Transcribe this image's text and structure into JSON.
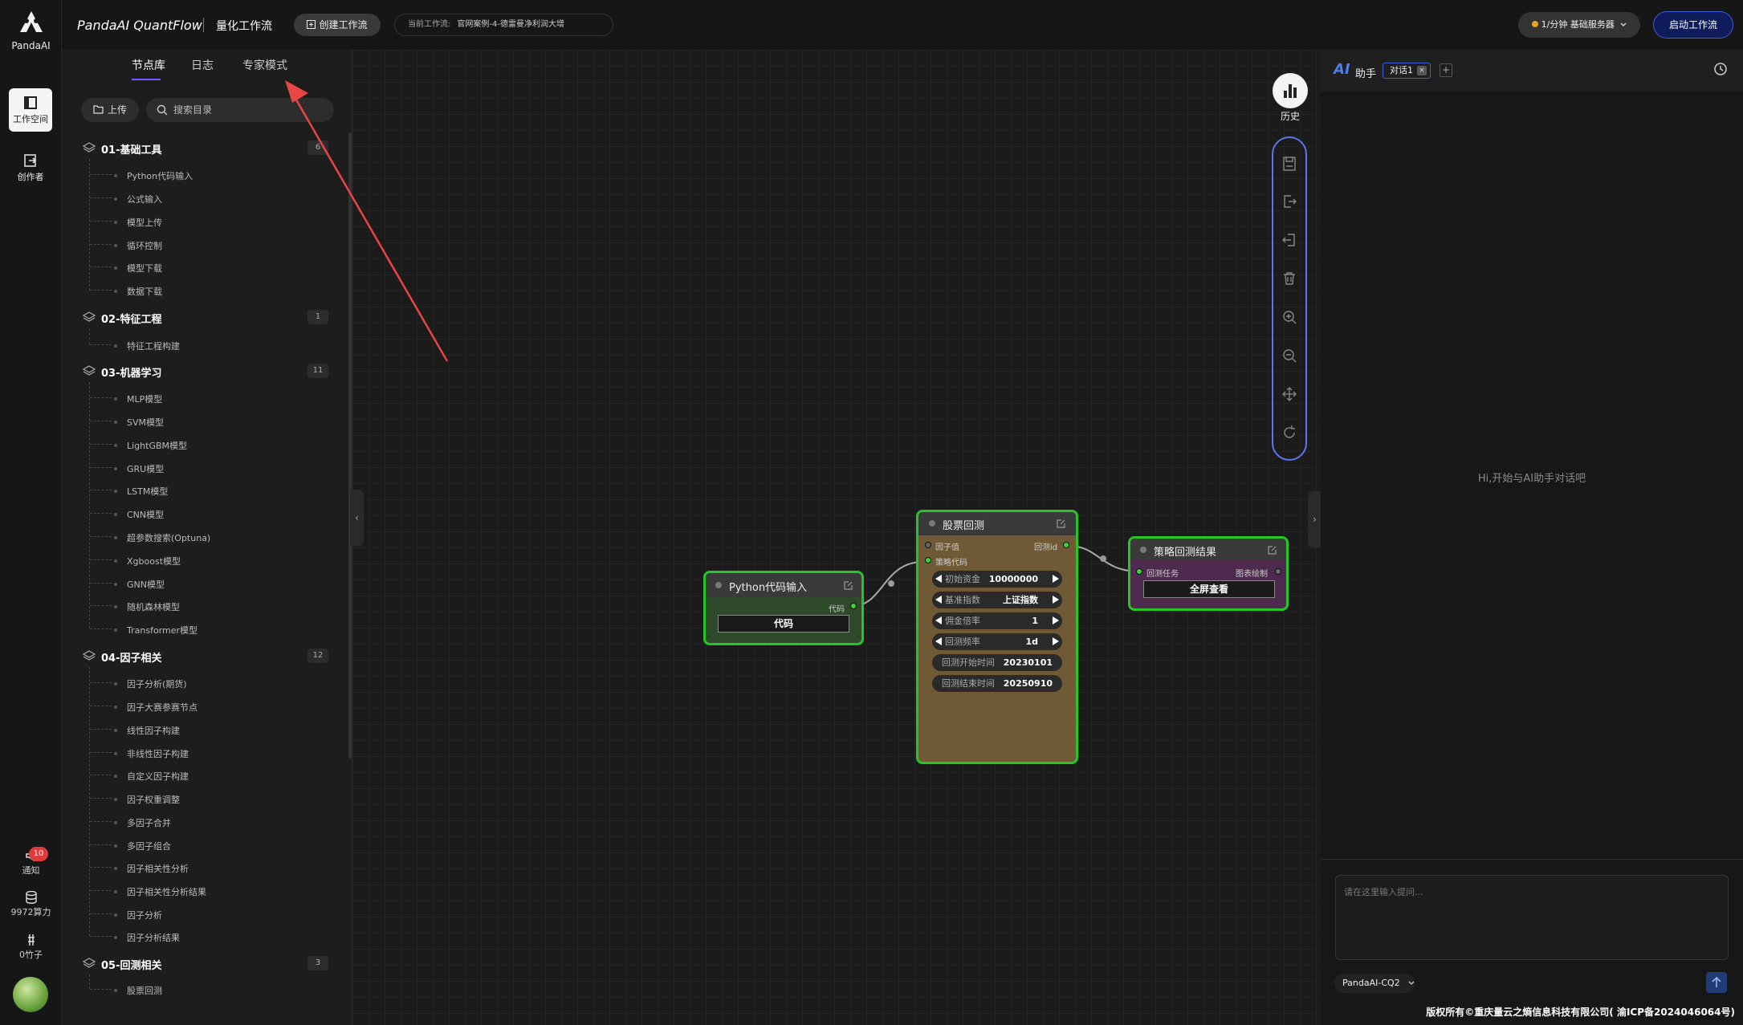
{
  "app": {
    "logo_text": "PandaAI",
    "brand": "PandaAI QuantFlow",
    "subtitle": "量化工作流"
  },
  "rail": {
    "workspace": "工作空间",
    "creator": "创作者",
    "notify": "通知",
    "notify_count": "10",
    "compute": "9972算力",
    "bamboo": "0竹子"
  },
  "topbar": {
    "create_label": "创建工作流",
    "current_label": "当前工作流:",
    "current_value": "官网案例-4-德雷曼净利润大增",
    "server_label": "1/分钟  基础服务器",
    "start_label": "启动工作流"
  },
  "panel": {
    "tabs": [
      "节点库",
      "日志",
      "专家模式"
    ],
    "upload": "上传",
    "search_placeholder": "搜索目录",
    "categories": [
      {
        "name": "01-基础工具",
        "count": "6",
        "items": [
          "Python代码输入",
          "公式输入",
          "模型上传",
          "循环控制",
          "模型下载",
          "数据下载"
        ]
      },
      {
        "name": "02-特征工程",
        "count": "1",
        "items": [
          "特征工程构建"
        ]
      },
      {
        "name": "03-机器学习",
        "count": "11",
        "items": [
          "MLP模型",
          "SVM模型",
          "LightGBM模型",
          "GRU模型",
          "LSTM模型",
          "CNN模型",
          "超参数搜索(Optuna)",
          "Xgboost模型",
          "GNN模型",
          "随机森林模型",
          "Transformer模型"
        ]
      },
      {
        "name": "04-因子相关",
        "count": "12",
        "items": [
          "因子分析(期货)",
          "因子大赛参赛节点",
          "线性因子构建",
          "非线性因子构建",
          "自定义因子构建",
          "因子权重调整",
          "多因子合并",
          "多因子组合",
          "因子相关性分析",
          "因子相关性分析结果",
          "因子分析",
          "因子分析结果"
        ]
      },
      {
        "name": "05-回测相关",
        "count": "3",
        "items": [
          "股票回测"
        ]
      }
    ]
  },
  "canvas": {
    "history_label": "历史",
    "toolbar_icons": [
      "save-icon",
      "export-icon",
      "import-icon",
      "delete-icon",
      "zoom-in-icon",
      "zoom-out-icon",
      "fit-view-icon",
      "refresh-icon"
    ],
    "nodes": {
      "python": {
        "title": "Python代码输入",
        "out_label": "代码",
        "button": "代码",
        "color": "#2f4a2a"
      },
      "backtest": {
        "title": "股票回测",
        "in_factor": "因子值",
        "in_strategy": "策略代码",
        "out_label": "回测id",
        "color": "#705a36",
        "fields": [
          {
            "k": "初始资金",
            "v": "10000000"
          },
          {
            "k": "基准指数",
            "v": "上证指数"
          },
          {
            "k": "佣金倍率",
            "v": "1"
          },
          {
            "k": "回测频率",
            "v": "1d"
          },
          {
            "k": "回测开始时间",
            "v": "20230101"
          },
          {
            "k": "回测结束时间",
            "v": "20250910"
          }
        ]
      },
      "result": {
        "title": "策略回测结果",
        "in_label": "回测任务",
        "out_label": "图表绘制",
        "button": "全屏查看",
        "color": "#4e2a4e"
      }
    }
  },
  "assistant": {
    "logo": "AI",
    "title": "助手",
    "tab": "对话1",
    "tab_close": "×",
    "add": "+",
    "empty": "Hi,开始与AI助手对话吧",
    "input_placeholder": "请在这里输入提问...",
    "model": "PandaAI-CQ2"
  },
  "footer": "版权所有©重庆量云之熵信息科技有限公司( 渝ICP备2024046064号)"
}
